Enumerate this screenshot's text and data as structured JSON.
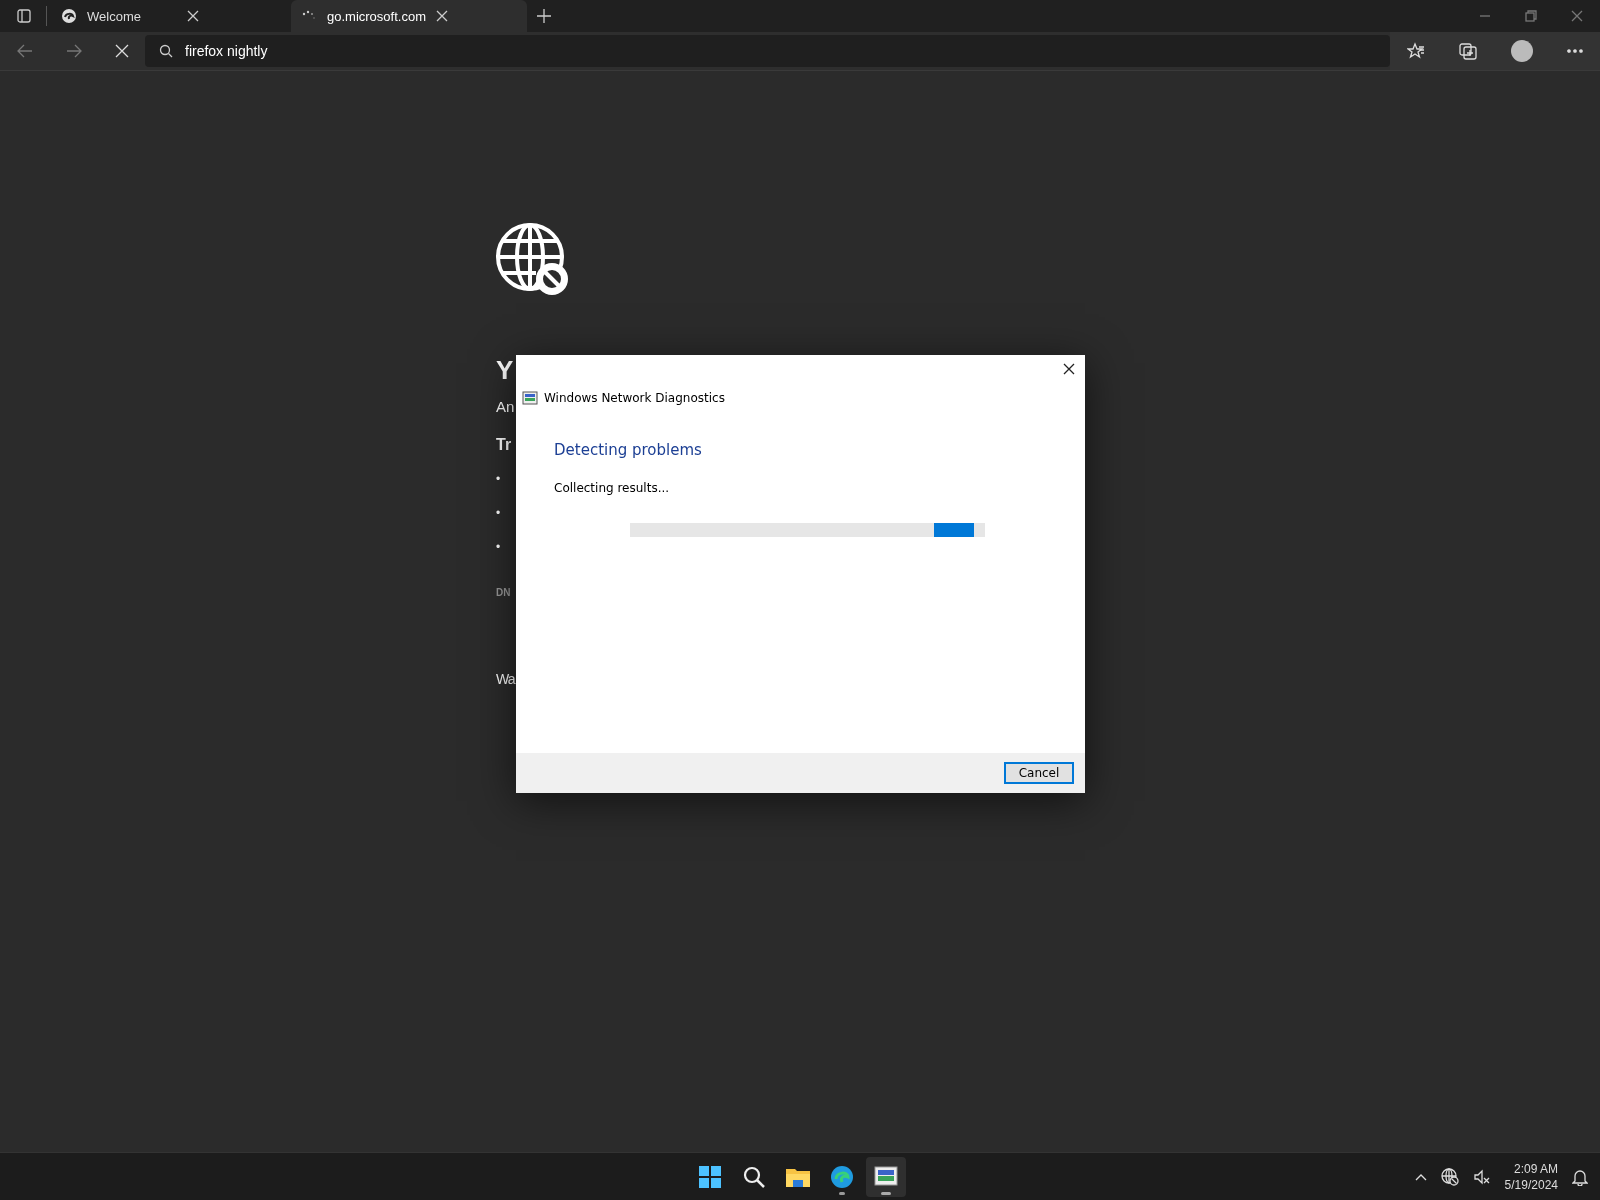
{
  "browser": {
    "tabs": [
      {
        "title": "Welcome",
        "selected": false,
        "loading": false
      },
      {
        "title": "go.microsoft.com",
        "selected": true,
        "loading": true
      }
    ],
    "address": {
      "value": "firefox nightly"
    }
  },
  "error_page": {
    "heading": "Y",
    "lines": [
      {
        "kind": "text",
        "text": "An"
      },
      {
        "kind": "bold",
        "text": "Tr"
      },
      {
        "kind": "bullet",
        "text": "•"
      },
      {
        "kind": "bullet",
        "text": "•"
      },
      {
        "kind": "bullet",
        "text": "•"
      },
      {
        "kind": "code",
        "text": "DN"
      },
      {
        "kind": "text",
        "text": "Wa"
      }
    ]
  },
  "dialog": {
    "title": "Windows Network Diagnostics",
    "heading": "Detecting problems",
    "status": "Collecting results...",
    "progress": {
      "level": 0.97
    },
    "buttons": [
      "Cancel"
    ]
  },
  "taskbar": {
    "apps": [
      {
        "kind": "start",
        "running": false,
        "selected": false
      },
      {
        "kind": "search",
        "running": false,
        "selected": false
      },
      {
        "kind": "files",
        "running": false,
        "selected": false
      },
      {
        "kind": "browser",
        "running": true,
        "selected": false
      },
      {
        "kind": "diagnostics",
        "running": true,
        "selected": true
      }
    ],
    "clock": {
      "time": "2:09 AM",
      "date": "5/19/2024"
    }
  }
}
